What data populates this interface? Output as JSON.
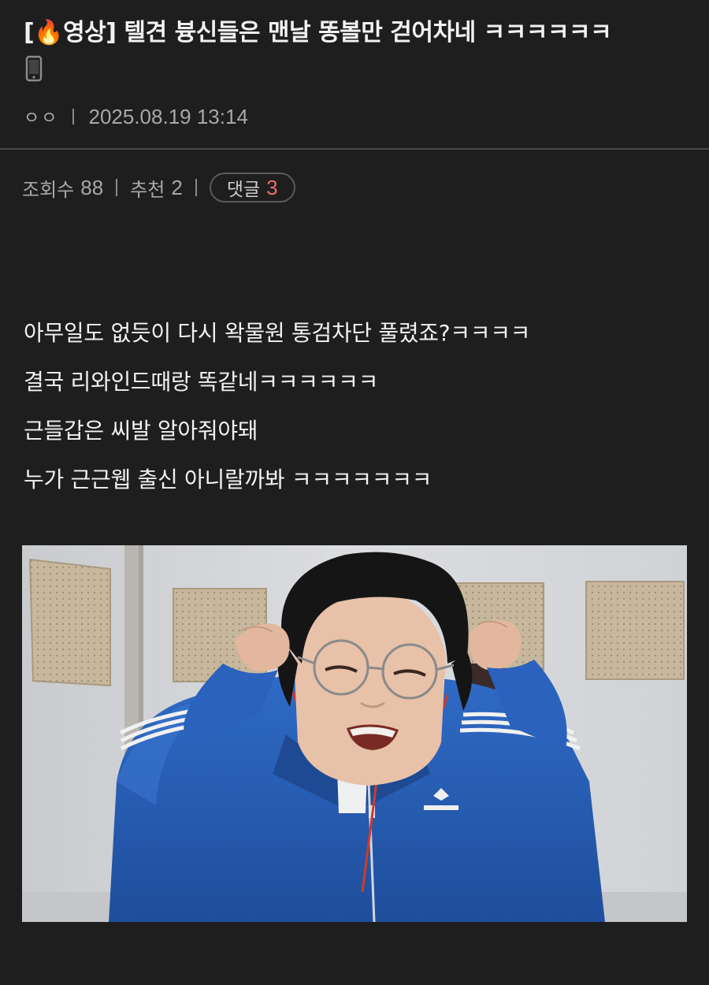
{
  "post": {
    "title_prefix": "[",
    "title_fire": "🔥",
    "title_rest": "영상] 텔견 븅신들은 맨날 똥볼만 걷어차네 ㅋㅋㅋㅋㅋㅋ",
    "device_icon": "mobile-phone-icon",
    "author": "ㅇㅇ",
    "date": "2025.08.19 13:14"
  },
  "stats": {
    "views_label": "조회수",
    "views": "88",
    "likes_label": "추천",
    "likes": "2",
    "comments_label": "댓글",
    "comments": "3"
  },
  "body": {
    "lines": [
      "아무일도 없듯이 다시 왁물원 통검차단 풀렸죠?ㅋㅋㅋㅋ",
      "결국 리와인드때랑 똑같네ㅋㅋㅋㅋㅋㅋ",
      "근들갑은 씨발 알아줘야돼",
      "누가 근근웹 출신 아니랄까봐 ㅋㅋㅋㅋㅋㅋㅋ"
    ]
  },
  "colors": {
    "background": "#1e1e1e",
    "comment_count": "#f26b6b",
    "jacket_blue": "#2a5fb8"
  }
}
